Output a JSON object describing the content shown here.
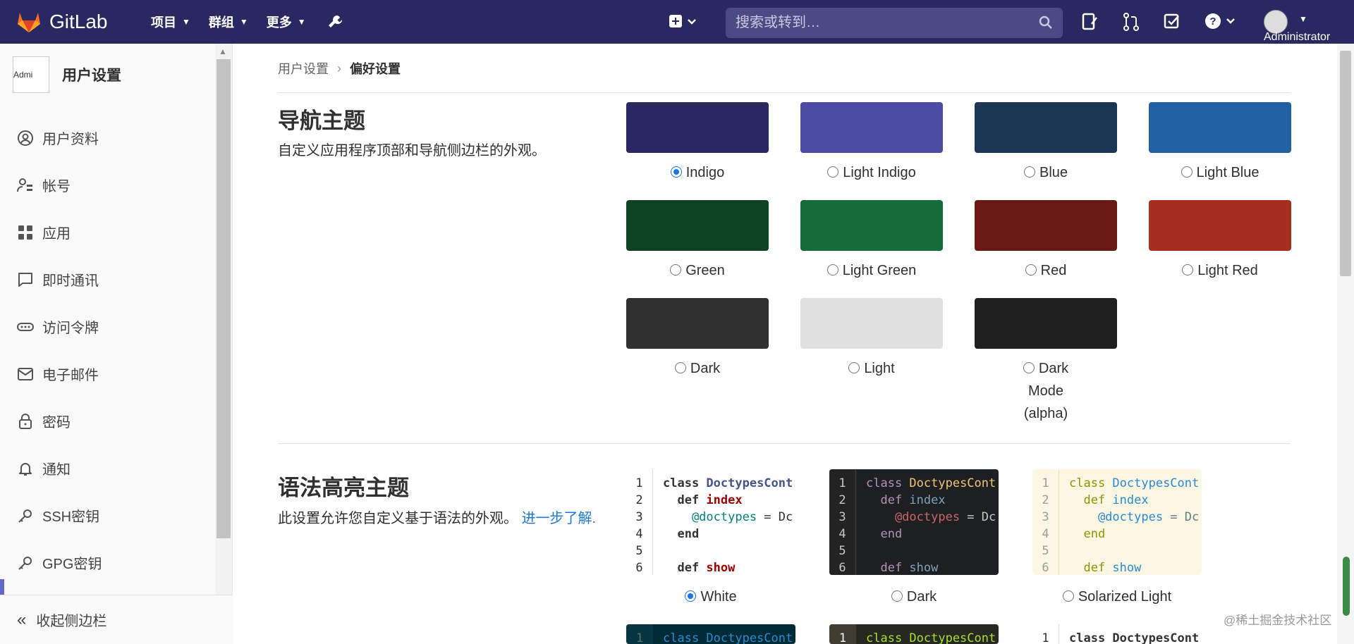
{
  "topbar": {
    "brand": "GitLab",
    "nav": [
      "项目",
      "群组",
      "更多"
    ],
    "search_placeholder": "搜索或转到…",
    "user": "Administrator"
  },
  "sidebar": {
    "avatar_alt": "Admi",
    "title": "用户设置",
    "items": [
      "用户资料",
      "帐号",
      "应用",
      "即时通讯",
      "访问令牌",
      "电子邮件",
      "密码",
      "通知",
      "SSH密钥",
      "GPG密钥"
    ],
    "collapse": "收起侧边栏"
  },
  "breadcrumb": {
    "parent": "用户设置",
    "current": "偏好设置"
  },
  "nav_theme": {
    "title": "导航主题",
    "description": "自定义应用程序顶部和导航侧边栏的外观。",
    "selected": "Indigo",
    "options": [
      {
        "label": "Indigo",
        "color": "#292961"
      },
      {
        "label": "Light Indigo",
        "color": "#4b4ba3"
      },
      {
        "label": "Blue",
        "color": "#1a3652"
      },
      {
        "label": "Light Blue",
        "color": "#2261a1"
      },
      {
        "label": "Green",
        "color": "#0d4524"
      },
      {
        "label": "Light Green",
        "color": "#156b39"
      },
      {
        "label": "Red",
        "color": "#691a16"
      },
      {
        "label": "Light Red",
        "color": "#a62e21"
      },
      {
        "label": "Dark",
        "color": "#303030"
      },
      {
        "label": "Light",
        "color": "#e0e0e0"
      },
      {
        "label": "Dark Mode (alpha)",
        "color": "#1f1f1f"
      }
    ]
  },
  "syntax_theme": {
    "title": "语法高亮主题",
    "description": "此设置允许您自定义基于语法的外观。",
    "link": "进一步了解.",
    "selected": "White",
    "line_numbers": [
      "1",
      "2",
      "3",
      "4",
      "5",
      "6"
    ],
    "code_lines": [
      "class DoctypesCont",
      "  def index",
      "    @doctypes = Dc",
      "  end",
      "",
      "  def show"
    ],
    "options": [
      "White",
      "Dark",
      "Solarized Light"
    ],
    "next_row_line": "class DoctypesCont"
  },
  "watermark": "@稀土掘金技术社区"
}
